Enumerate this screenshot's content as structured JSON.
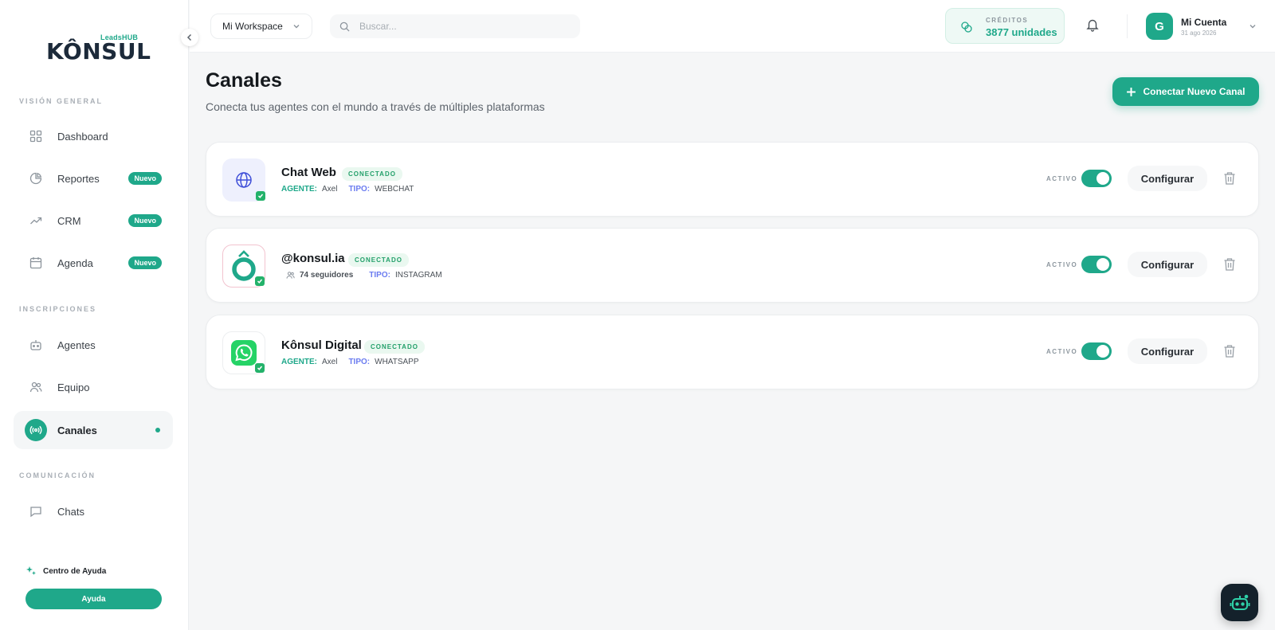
{
  "brand": {
    "name": "KÔNSUL",
    "tag": "LeadsHUB"
  },
  "sidebar": {
    "sections": [
      {
        "label": "VISIÓN GENERAL"
      },
      {
        "label": "INSCRIPCIONES"
      },
      {
        "label": "COMUNICACIÓN"
      }
    ],
    "items": [
      {
        "label": "Dashboard",
        "icon": "grid-icon"
      },
      {
        "label": "Reportes",
        "icon": "pie-chart-icon",
        "badge": "Nuevo"
      },
      {
        "label": "CRM",
        "icon": "trending-up-icon",
        "badge": "Nuevo"
      },
      {
        "label": "Agenda",
        "icon": "calendar-icon",
        "badge": "Nuevo"
      },
      {
        "label": "Agentes",
        "icon": "bot-icon"
      },
      {
        "label": "Equipo",
        "icon": "users-icon"
      },
      {
        "label": "Canales",
        "icon": "broadcast-icon",
        "active": true
      },
      {
        "label": "Chats",
        "icon": "chat-icon"
      }
    ],
    "help_title": "Centro de Ayuda",
    "help_button": "Ayuda"
  },
  "header": {
    "workspace": "Mi Workspace",
    "search_placeholder": "Buscar...",
    "credits_label": "CRÉDITOS",
    "credits_value": "3877 unidades",
    "account_initial": "G",
    "account_name": "Mi Cuenta",
    "account_date": "31 ago 2026"
  },
  "main": {
    "title": "Canales",
    "subtitle": "Conecta tus agentes con el mundo a través de múltiples plataformas",
    "connect_button": "Conectar Nuevo Canal",
    "active_label": "ACTIVO",
    "configure_label": "Configurar",
    "channels": [
      {
        "name": "Chat Web",
        "status": "CONECTADO",
        "agent_key": "AGENTE:",
        "agent": "Axel",
        "type_key": "TIPO:",
        "type": "WEBCHAT",
        "icon": "globe-icon",
        "active": true
      },
      {
        "name": "@konsul.ia",
        "status": "CONECTADO",
        "followers": "74 seguidores",
        "type_key": "TIPO:",
        "type": "INSTAGRAM",
        "icon": "konsul-logo-icon",
        "active": true
      },
      {
        "name": "Kônsul Digital",
        "status": "CONECTADO",
        "agent_key": "AGENTE:",
        "agent": "Axel",
        "type_key": "TIPO:",
        "type": "WHATSAPP",
        "icon": "whatsapp-icon",
        "active": true
      }
    ]
  },
  "colors": {
    "accent": "#1fa88a",
    "status_green": "#23a06a",
    "type_blue": "#6b7cf0",
    "dark": "#14212b"
  }
}
